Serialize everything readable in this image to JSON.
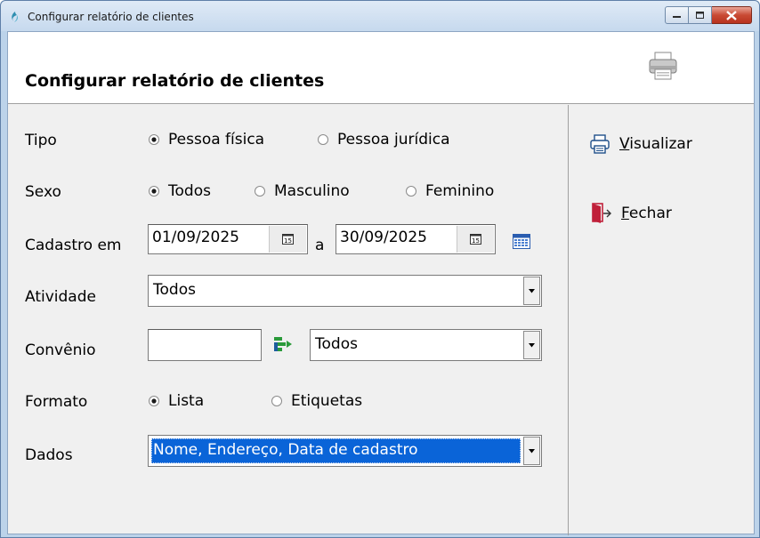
{
  "window": {
    "title": "Configurar relatório de clientes"
  },
  "header": {
    "title": "Configurar relatório de clientes"
  },
  "form": {
    "tipo": {
      "label": "Tipo",
      "options": [
        "Pessoa física",
        "Pessoa jurídica"
      ],
      "selected": "Pessoa física"
    },
    "sexo": {
      "label": "Sexo",
      "options": [
        "Todos",
        "Masculino",
        "Feminino"
      ],
      "selected": "Todos"
    },
    "cadastro": {
      "label": "Cadastro em",
      "from": "01/09/2025",
      "separator": "a",
      "to": "30/09/2025",
      "picker_day": "15"
    },
    "atividade": {
      "label": "Atividade",
      "value": "Todos"
    },
    "convenio": {
      "label": "Convênio",
      "code": "",
      "value": "Todos"
    },
    "formato": {
      "label": "Formato",
      "options": [
        "Lista",
        "Etiquetas"
      ],
      "selected": "Lista"
    },
    "dados": {
      "label": "Dados",
      "value": "Nome, Endereço, Data de cadastro"
    }
  },
  "actions": {
    "visualizar": {
      "mnemonic": "V",
      "rest": "isualizar"
    },
    "fechar": {
      "mnemonic": "F",
      "rest": "echar"
    }
  },
  "colors": {
    "selection": "#0a64d8",
    "close_icon": "#c0203a",
    "list_icon_green": "#2a9a3a"
  }
}
